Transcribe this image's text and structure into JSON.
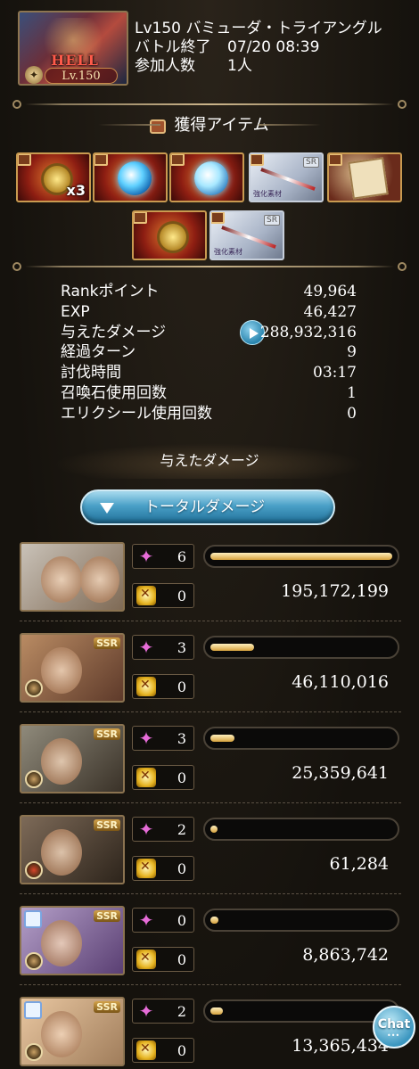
{
  "battle": {
    "title": "Lv150 バミューダ・トライアングル",
    "end_label": "バトル終了",
    "end_time": "07/20 08:39",
    "participants_label": "参加人数",
    "participants_value": "1人",
    "thumb_difficulty": "HELL",
    "thumb_level": "Lv.150"
  },
  "items_section": {
    "title": "獲得アイテム",
    "items": [
      {
        "icon": "gold-medal-icon",
        "qty": "x3"
      },
      {
        "icon": "blue-orb-icon",
        "qty": ""
      },
      {
        "icon": "crystal-orb-icon",
        "qty": ""
      },
      {
        "icon": "sword-icon",
        "rarity": "SR",
        "tag": "強化素材"
      },
      {
        "icon": "scroll-icon",
        "qty": ""
      },
      {
        "icon": "gold-medal-icon",
        "qty": ""
      },
      {
        "icon": "sword-icon",
        "rarity": "SR",
        "tag": "強化素材"
      }
    ]
  },
  "stats": [
    {
      "label": "Rankポイント",
      "value": "49,964"
    },
    {
      "label": "EXP",
      "value": "46,427"
    },
    {
      "label": "与えたダメージ",
      "value": "288,932,316"
    },
    {
      "label": "経過ターン",
      "value": "9"
    },
    {
      "label": "討伐時間",
      "value": "03:17"
    },
    {
      "label": "召喚石使用回数",
      "value": "1"
    },
    {
      "label": "エリクシール使用回数",
      "value": "0"
    }
  ],
  "damage_section": {
    "heading": "与えたダメージ",
    "toggle_label": "トータルダメージ"
  },
  "members": [
    {
      "stars": "6",
      "bursts": "0",
      "damage": "195,172,199",
      "bar_fraction": 1.0,
      "ssr": "",
      "colors": [
        "#c9c2b8",
        "#7f6a55"
      ]
    },
    {
      "stars": "3",
      "bursts": "0",
      "damage": "46,110,016",
      "bar_fraction": 0.24,
      "ssr": "SSR",
      "colors": [
        "#b98b63",
        "#5e3a2a"
      ]
    },
    {
      "stars": "3",
      "bursts": "0",
      "damage": "25,359,641",
      "bar_fraction": 0.13,
      "ssr": "SSR",
      "colors": [
        "#8f8a7b",
        "#3a3228"
      ]
    },
    {
      "stars": "2",
      "bursts": "0",
      "damage": "61,284",
      "bar_fraction": 0.0,
      "ssr": "SSR",
      "colors": [
        "#7d6a58",
        "#2d241b"
      ]
    },
    {
      "stars": "0",
      "bursts": "0",
      "damage": "8,863,742",
      "bar_fraction": 0.045,
      "ssr": "SSR",
      "colors": [
        "#b49fc8",
        "#5a3f73"
      ]
    },
    {
      "stars": "2",
      "bursts": "0",
      "damage": "13,365,434",
      "bar_fraction": 0.07,
      "ssr": "SSR",
      "colors": [
        "#e9c7a1",
        "#a07d5b"
      ]
    }
  ],
  "chat_label": "Chat"
}
